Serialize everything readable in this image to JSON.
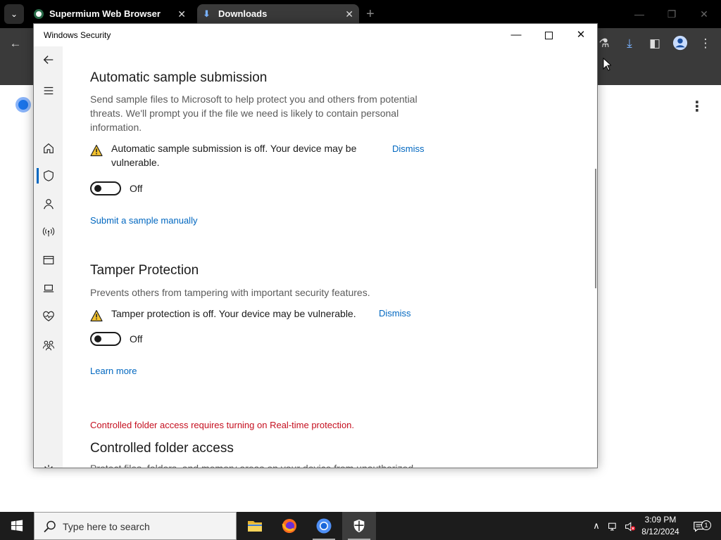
{
  "browser": {
    "tabs": [
      {
        "label": "Supermium Web Browser",
        "close": "✕"
      },
      {
        "label": "Downloads",
        "close": "✕"
      }
    ],
    "new_tab": "+",
    "window_controls": {
      "minimize": "—",
      "restore": "❐",
      "close": "✕"
    }
  },
  "security_window": {
    "title": "Windows Security",
    "controls": {
      "minimize": "—",
      "close": "✕"
    },
    "nav_icons": [
      "back-arrow-icon",
      "hamburger-menu-icon",
      "home-icon",
      "shield-icon",
      "person-icon",
      "wireless-icon",
      "app-browser-icon",
      "laptop-icon",
      "health-heart-icon",
      "family-icon",
      "gear-icon"
    ],
    "sample_submission": {
      "title": "Automatic sample submission",
      "description": "Send sample files to Microsoft to help protect you and others from potential threats. We'll prompt you if the file we need is likely to contain personal information.",
      "warning": "Automatic sample submission is off. Your device may be vulnerable.",
      "dismiss": "Dismiss",
      "toggle_state": "Off",
      "link": "Submit a sample manually"
    },
    "tamper_protection": {
      "title": "Tamper Protection",
      "description": "Prevents others from tampering with important security features.",
      "warning": "Tamper protection is off. Your device may be vulnerable.",
      "dismiss": "Dismiss",
      "toggle_state": "Off",
      "link": "Learn more"
    },
    "controlled_folder": {
      "error": "Controlled folder access requires turning on Real-time protection.",
      "title": "Controlled folder access",
      "description_cut": "Protect files, folders, and memory areas on your device from unauthorized"
    }
  },
  "taskbar": {
    "search_placeholder": "Type here to search",
    "apps": [
      "file-explorer",
      "firefox",
      "chromium",
      "windows-security"
    ],
    "clock": {
      "time": "3:09 PM",
      "date": "8/12/2024"
    },
    "notification_count": "1"
  },
  "colors": {
    "accent": "#0067c0",
    "error": "#c50f1f",
    "warning": "#f2c12e"
  }
}
